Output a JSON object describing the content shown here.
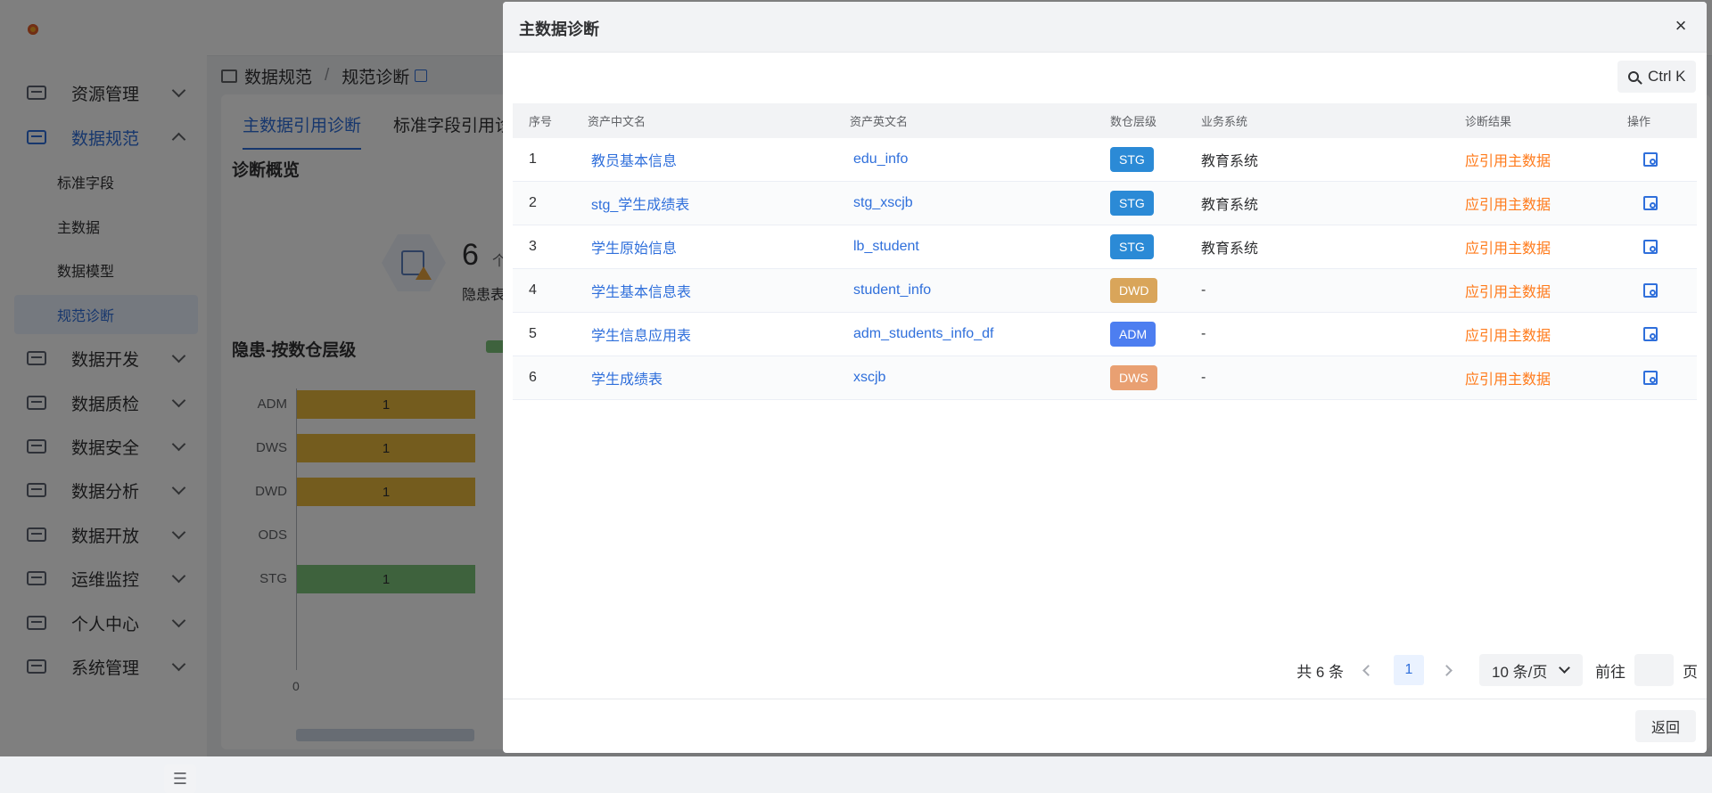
{
  "sidebar": {
    "items": [
      {
        "label": "资源管理",
        "open": false
      },
      {
        "label": "数据规范",
        "open": true
      },
      {
        "label": "数据开发",
        "open": false
      },
      {
        "label": "数据质检",
        "open": false
      },
      {
        "label": "数据安全",
        "open": false
      },
      {
        "label": "数据分析",
        "open": false
      },
      {
        "label": "数据开放",
        "open": false
      },
      {
        "label": "运维监控",
        "open": false
      },
      {
        "label": "个人中心",
        "open": false
      },
      {
        "label": "系统管理",
        "open": false
      }
    ],
    "sub_items": [
      "标准字段",
      "主数据",
      "数据模型",
      "规范诊断"
    ],
    "active_sub": "规范诊断"
  },
  "breadcrumb": {
    "parent": "数据规范",
    "separator": "/",
    "current": "规范诊断"
  },
  "tabs": [
    "主数据引用诊断",
    "标准字段引用诊"
  ],
  "overview": {
    "title": "诊断概览",
    "count": "6",
    "unit": "个",
    "label": "隐患表总"
  },
  "chart_data": {
    "type": "bar",
    "orientation": "horizontal",
    "title": "隐患-按数仓层级",
    "categories": [
      "ADM",
      "DWS",
      "DWD",
      "ODS",
      "STG"
    ],
    "values": [
      1,
      1,
      1,
      0,
      1
    ],
    "data_labels": [
      "1",
      "1",
      "1",
      "",
      "1"
    ],
    "bar_colors": [
      "#e8b93c",
      "#e8b93c",
      "#e8b93c",
      "#e8b93c",
      "#7cc47a"
    ],
    "x_tick_labels": [
      "0"
    ],
    "legend_position": "top"
  },
  "drawer": {
    "title": "主数据诊断",
    "close_glyph": "×",
    "search_label": "Ctrl K",
    "columns": [
      "序号",
      "资产中文名",
      "资产英文名",
      "数仓层级",
      "业务系统",
      "诊断结果",
      "操作"
    ],
    "rows": [
      {
        "idx": "1",
        "cn": "教员基本信息",
        "en": "edu_info",
        "level": "STG",
        "system": "教育系统",
        "result": "应引用主数据"
      },
      {
        "idx": "2",
        "cn": "stg_学生成绩表",
        "en": "stg_xscjb",
        "level": "STG",
        "system": "教育系统",
        "result": "应引用主数据"
      },
      {
        "idx": "3",
        "cn": "学生原始信息",
        "en": "lb_student",
        "level": "STG",
        "system": "教育系统",
        "result": "应引用主数据"
      },
      {
        "idx": "4",
        "cn": "学生基本信息表",
        "en": "student_info",
        "level": "DWD",
        "system": "-",
        "result": "应引用主数据"
      },
      {
        "idx": "5",
        "cn": "学生信息应用表",
        "en": "adm_students_info_df",
        "level": "ADM",
        "system": "-",
        "result": "应引用主数据"
      },
      {
        "idx": "6",
        "cn": "学生成绩表",
        "en": "xscjb",
        "level": "DWS",
        "system": "-",
        "result": "应引用主数据"
      }
    ],
    "level_colors": {
      "STG": "#2b8ad6",
      "DWD": "#d9a55a",
      "ADM": "#4d7ef0",
      "DWS": "#e9a072"
    },
    "pagination": {
      "total": "共 6 条",
      "page": "1",
      "page_size": "10 条/页",
      "goto_prefix": "前往",
      "goto_suffix": "页"
    },
    "back_label": "返回"
  }
}
